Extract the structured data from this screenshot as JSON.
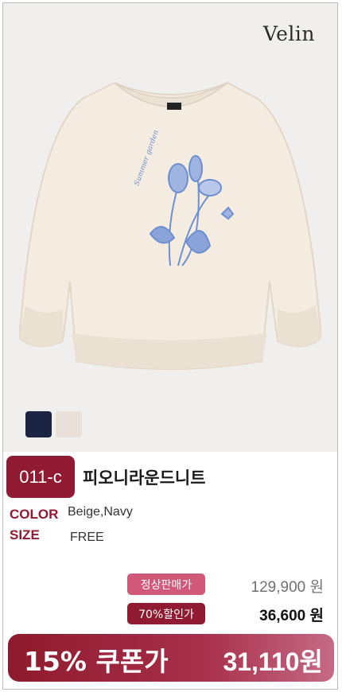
{
  "brand": {
    "logo": "Velin"
  },
  "product": {
    "code": "011-c",
    "name": "피오니라운드니트",
    "swatches": [
      {
        "name": "Navy",
        "color": "#1c2444"
      },
      {
        "name": "Beige",
        "color": "#e8e0d8"
      }
    ],
    "options": {
      "color_label": "COLOR",
      "color_value": "Beige,Navy",
      "size_label": "SIZE",
      "size_value": "FREE"
    }
  },
  "pricing": {
    "normal_label": "정상판매가",
    "normal_price": "129,900 원",
    "sale_label": "70%할인가",
    "sale_price": "36,600 원",
    "coupon_label": "15% 쿠폰가",
    "coupon_price": "31,110원"
  },
  "colors": {
    "accent": "#8f1a31",
    "pink": "#d2587a",
    "hero_bg": "#f0efee"
  }
}
